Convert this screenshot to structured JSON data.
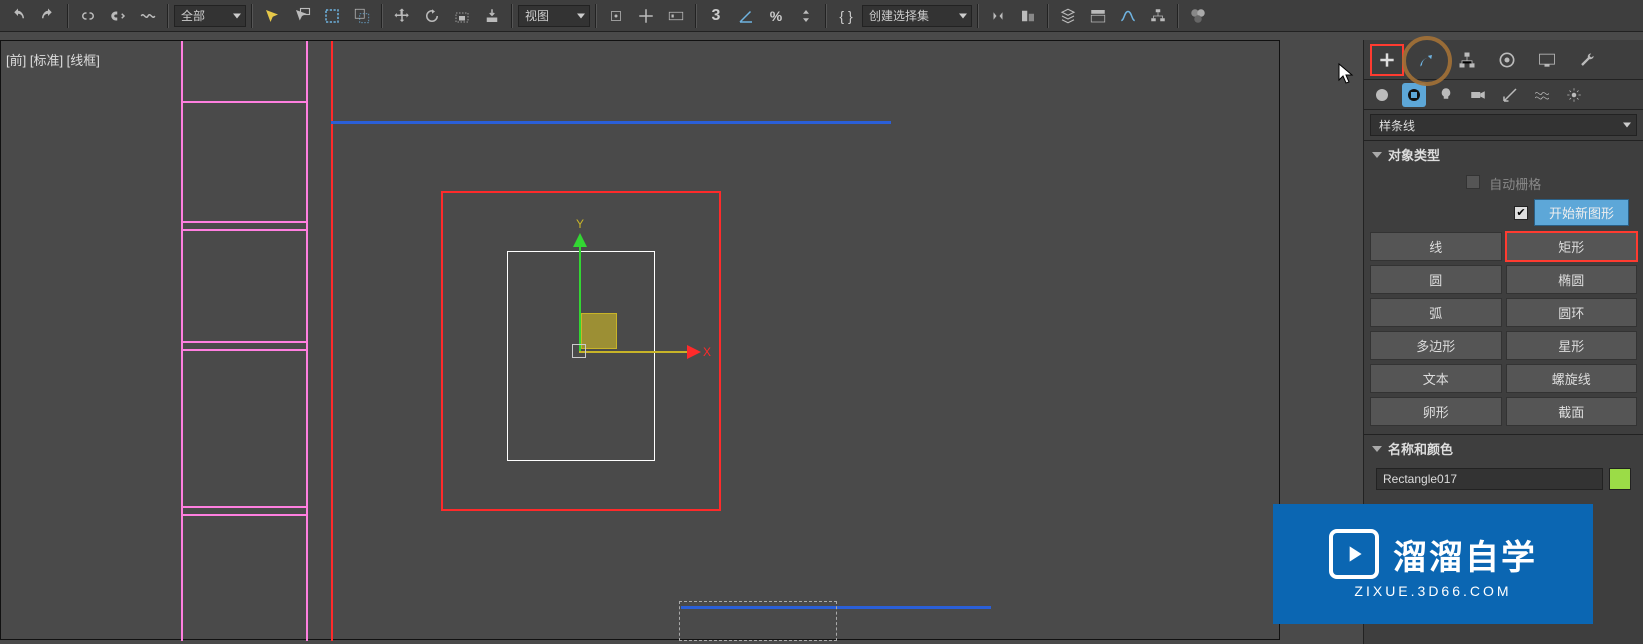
{
  "toolbar": {
    "scope_dropdown": "全部",
    "view_dropdown": "视图",
    "selection_set_dropdown": "创建选择集",
    "x_value": "3"
  },
  "viewport": {
    "label": "[前] [标准] [线框]",
    "axis_x": "X",
    "axis_y": "Y"
  },
  "panel": {
    "category_dropdown": "样条线",
    "rollout_object_type": "对象类型",
    "auto_grid_label": "自动栅格",
    "start_new_shape": "开始新图形",
    "buttons": {
      "line": "线",
      "rectangle": "矩形",
      "circle": "圆",
      "ellipse": "椭圆",
      "arc": "弧",
      "donut": "圆环",
      "ngon": "多边形",
      "star": "星形",
      "text": "文本",
      "helix": "螺旋线",
      "egg": "卵形",
      "section": "截面"
    },
    "rollout_name_color": "名称和颜色",
    "object_name": "Rectangle017"
  },
  "watermark": {
    "title": "溜溜自学",
    "sub": "ZIXUE.3D66.COM"
  }
}
